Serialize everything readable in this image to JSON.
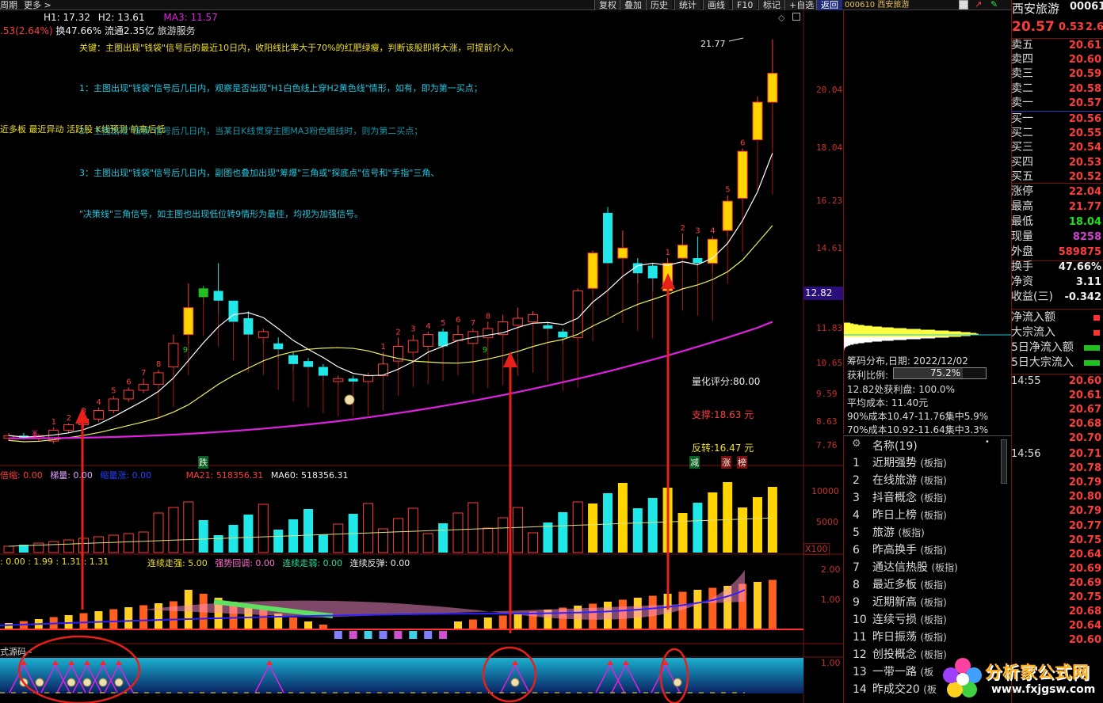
{
  "topbar": {
    "left_label": "周期",
    "more_label": "更多 >",
    "buttons": [
      "复权",
      "叠加",
      "历史",
      "统计",
      "画线",
      "F10",
      "标记",
      "+自选",
      "返回"
    ],
    "active_button": "返回"
  },
  "info_bar": {
    "h1": "H1: 17.32",
    "h2": "H2: 13.61",
    "ma3": "MA3: 11.57"
  },
  "info_bar2": {
    "change": ".53(2.64%)",
    "turnover": "换47.66%",
    "float": "流通2.35亿",
    "industry": "旅游服务"
  },
  "annotations": {
    "key": "关键：主图出现\"钱袋\"信号后的最近10日内，收阳线比率大于70%的红肥绿瘦，判断该股即将大涨，可提前介入。",
    "p1": "1：主图出现\"钱袋\"信号后几日内，观察是否出现\"H1白色线上穿H2黄色线\"情形，如有，即为第一买点；",
    "p2": "2：主图出现\"钱袋\"信号后几日内，当某日K线贯穿主图MA3粉色粗线时，则为第二买点；",
    "p2_overlay": "近多板 最近异动 活跃股 K线预测 前高后低",
    "p3": "3：主图出现\"钱袋\"信号后几日内，副图也叠加出现\"筹爆\"三角或\"探底点\"信号和\"手指\"三角、",
    "p4": "\"决策线\"三角信号，如主图也出现低位转9情形为最佳，均视为加强信号。"
  },
  "main_chart": {
    "y_ticks": [
      "20.04",
      "18.04",
      "16.23",
      "14.61",
      "11.83",
      "10.65",
      "9.59",
      "8.63",
      "7.76"
    ],
    "price_badge": "12.82",
    "high_label": "21.77",
    "quant_score": "量化评分:80.00",
    "support": "支撑:18.63 元",
    "reversal": "反转:16.47 元",
    "tags": {
      "die": "跌",
      "jian": "减",
      "zhang": "涨",
      "bang": "榜"
    },
    "seq_top_left": [
      "1",
      "2",
      "3",
      "4",
      "5",
      "6",
      "7",
      "8"
    ],
    "seq_mid": [
      "1",
      "2",
      "3",
      "4",
      "5",
      "6",
      "7",
      "8"
    ],
    "seq_right": [
      "1",
      "2",
      "3",
      "4",
      "5",
      "6"
    ],
    "nine_labels": [
      "9",
      "9"
    ]
  },
  "vol_panel": {
    "label1": "倍缩: 0.00",
    "label2": "梯量: 0.00",
    "label3": "缩量涨: 0.00",
    "ma21": "MA21: 518356.31",
    "ma60": "MA60: 518356.31",
    "y_ticks": [
      "10000",
      "5000"
    ],
    "unit": "X100",
    "bei": "倍"
  },
  "ind_panel": {
    "vals": ": 0.00  : 1.99  : 1.31  : 1.31",
    "strong": "连续走强: 5.00",
    "pullback": "强势回调: 0.00",
    "weak": "连续走弱: 0.00",
    "rebound": "连续反弹: 0.00",
    "y_ticks": [
      "2.00",
      "1.00"
    ]
  },
  "bottom_panel": {
    "label": "式源码 -",
    "y_tick": "1.00"
  },
  "quote": {
    "code_tab": "000610 西安旅游",
    "name": "西安旅游",
    "code": "00061",
    "price": "20.57",
    "change": "0.53",
    "pct": "2.6",
    "order_book": [
      {
        "k": "卖五",
        "v": "20.61"
      },
      {
        "k": "卖四",
        "v": "20.60"
      },
      {
        "k": "卖三",
        "v": "20.59"
      },
      {
        "k": "卖二",
        "v": "20.58"
      },
      {
        "k": "卖一",
        "v": "20.57"
      },
      {
        "k": "买一",
        "v": "20.56"
      },
      {
        "k": "买二",
        "v": "20.55"
      },
      {
        "k": "买三",
        "v": "20.54"
      },
      {
        "k": "买四",
        "v": "20.53"
      },
      {
        "k": "买五",
        "v": "20.52"
      }
    ],
    "stats": [
      {
        "k": "涨停",
        "v": "22.04",
        "c": "#ff3c3c"
      },
      {
        "k": "最高",
        "v": "21.77",
        "c": "#ff3c3c"
      },
      {
        "k": "最低",
        "v": "18.04",
        "c": "#20e020"
      },
      {
        "k": "现量",
        "v": "8258",
        "c": "#d040d0"
      },
      {
        "k": "外盘",
        "v": "589875",
        "c": "#ff3c3c"
      },
      {
        "k": "换手",
        "v": "47.66%",
        "c": "#eeeeee"
      },
      {
        "k": "净资",
        "v": "3.11",
        "c": "#eeeeee"
      },
      {
        "k": "收益(三)",
        "v": "-0.342",
        "c": "#eeeeee"
      }
    ],
    "flows": [
      "净流入额",
      "大宗流入",
      "5日净流入额",
      "5日大宗流入"
    ]
  },
  "chip": {
    "date_line": "筹码分布,日期: 2022/12/02",
    "profit_ratio_label": "获利比例:",
    "profit_ratio": "75.2%",
    "profit_at": "12.82处获利盘: 100.0%",
    "avg_cost": "平均成本: 11.40元",
    "cost90": "90%成本10.47-11.76集中5.9%",
    "cost70": "70%成本10.92-11.64集中3.3%"
  },
  "concepts": {
    "header": "名称(19)",
    "items": [
      {
        "n": "1",
        "name": "近期强势",
        "tag": "(板指)"
      },
      {
        "n": "2",
        "name": "在线旅游",
        "tag": "(板指)"
      },
      {
        "n": "3",
        "name": "抖音概念",
        "tag": "(板指)"
      },
      {
        "n": "4",
        "name": "昨日上榜",
        "tag": "(板指)"
      },
      {
        "n": "5",
        "name": "旅游",
        "tag": "(板指)"
      },
      {
        "n": "6",
        "name": "昨高换手",
        "tag": "(板指)"
      },
      {
        "n": "7",
        "name": "通达信热股",
        "tag": "(板指)"
      },
      {
        "n": "8",
        "name": "最近多板",
        "tag": "(板指)"
      },
      {
        "n": "9",
        "name": "近期新高",
        "tag": "(板指)"
      },
      {
        "n": "10",
        "name": "连续亏损",
        "tag": "(板指)"
      },
      {
        "n": "11",
        "name": "昨日振荡",
        "tag": "(板指)"
      },
      {
        "n": "12",
        "name": "创投概念",
        "tag": "(板指)"
      },
      {
        "n": "13",
        "name": "一带一路",
        "tag": "(板"
      },
      {
        "n": "14",
        "name": "昨成交20",
        "tag": "(板"
      }
    ]
  },
  "ticks": {
    "time1": "14:55",
    "time2": "14:56",
    "prices1": [
      "20.60",
      "20.61",
      "20.67",
      "20.68",
      "20.70"
    ],
    "prices2": [
      "20.71",
      "20.78",
      "20.79",
      "20.80",
      "20.79",
      "20.77",
      "20.75",
      "20.64",
      "20.69",
      "20.69",
      "20.75",
      "20.68",
      "20.64",
      "20.60"
    ]
  },
  "watermark": {
    "brand": "分析家公式网",
    "url": "www.fxjgsw.com"
  },
  "colors": {
    "up": "#ff3c3c",
    "down": "#20e8e8",
    "yellow_candle": "#ffd400",
    "ma_white": "#ffffff",
    "ma_yellow": "#f0f060",
    "ma_magenta": "#e020e0",
    "arrow": "#e8201a"
  }
}
